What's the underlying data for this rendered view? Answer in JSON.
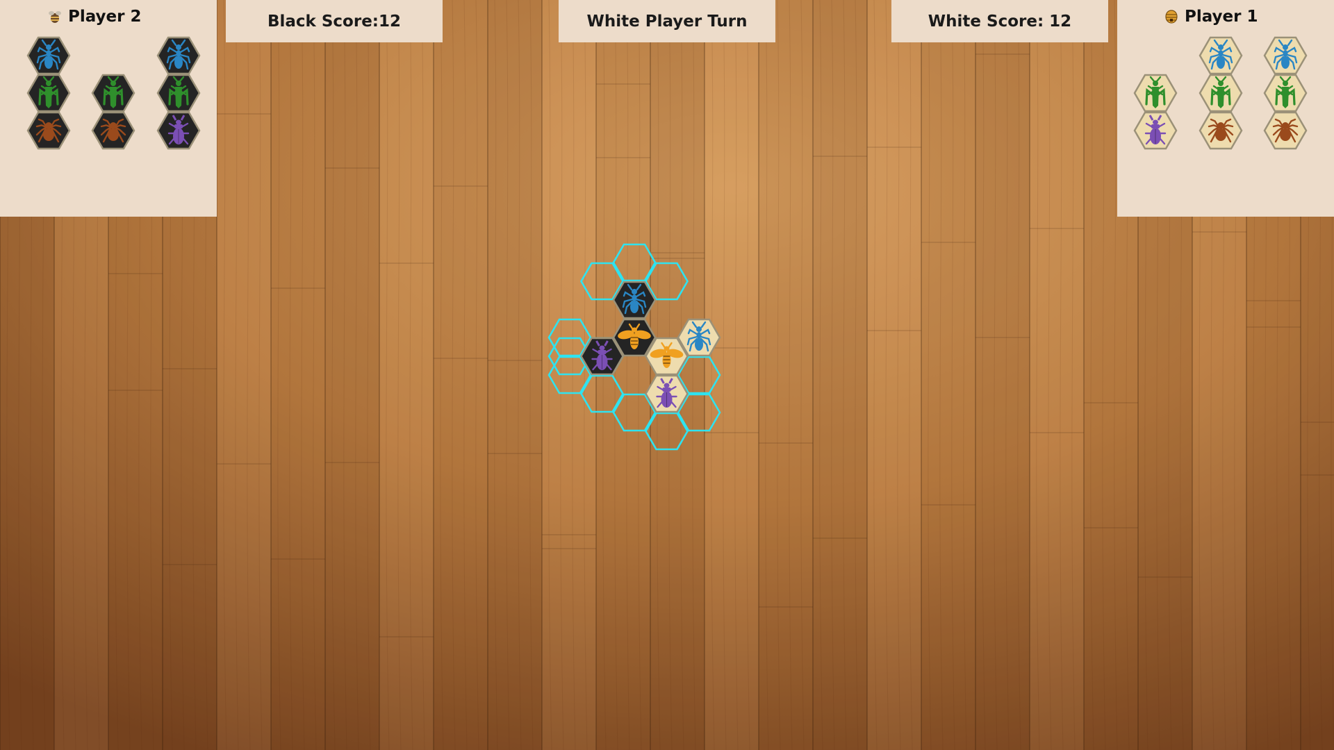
{
  "hud": {
    "black_score": "Black Score:12",
    "turn_status": "White Player Turn",
    "white_score": "White Score: 12"
  },
  "players": {
    "player2": {
      "name": "Player 2",
      "color": "black",
      "icon": "bee-icon",
      "hand": [
        {
          "bug": "ant",
          "icon": "ant-icon"
        },
        {
          "bug": "grasshopper",
          "icon": "grasshopper-icon"
        },
        {
          "bug": "spider",
          "icon": "spider-icon"
        },
        {
          "bug": "grasshopper",
          "icon": "grasshopper-icon"
        },
        {
          "bug": "spider",
          "icon": "spider-icon"
        },
        {
          "bug": "ant",
          "icon": "ant-icon"
        },
        {
          "bug": "grasshopper",
          "icon": "grasshopper-icon"
        },
        {
          "bug": "beetle",
          "icon": "beetle-icon"
        }
      ]
    },
    "player1": {
      "name": "Player 1",
      "color": "white",
      "icon": "beehive-icon",
      "hand": [
        {
          "bug": "grasshopper",
          "icon": "grasshopper-icon"
        },
        {
          "bug": "beetle",
          "icon": "beetle-icon"
        },
        {
          "bug": "ant",
          "icon": "ant-icon"
        },
        {
          "bug": "grasshopper",
          "icon": "grasshopper-icon"
        },
        {
          "bug": "spider",
          "icon": "spider-icon"
        },
        {
          "bug": "ant",
          "icon": "ant-icon"
        },
        {
          "bug": "grasshopper",
          "icon": "grasshopper-icon"
        },
        {
          "bug": "spider",
          "icon": "spider-icon"
        }
      ]
    }
  },
  "board": {
    "pieces": [
      {
        "owner": "black",
        "bug": "ant",
        "icon": "ant-icon"
      },
      {
        "owner": "black",
        "bug": "queen-bee",
        "icon": "bee-icon"
      },
      {
        "owner": "black",
        "bug": "beetle",
        "icon": "beetle-icon"
      },
      {
        "owner": "white",
        "bug": "ant",
        "icon": "ant-icon"
      },
      {
        "owner": "white",
        "bug": "queen-bee",
        "icon": "bee-icon"
      },
      {
        "owner": "white",
        "bug": "beetle",
        "icon": "beetle-icon"
      }
    ],
    "valid_move_count": 12
  },
  "colors": {
    "panel": "#eddcca",
    "black_tile": "#242424",
    "white_tile": "#eedcae",
    "tile_border": "#9b9178",
    "highlight": "#2ee3f0",
    "ant": "#2a86c4",
    "grasshopper": "#2f8f2c",
    "spider": "#9a4a1c",
    "beetle": "#7b4fb4",
    "bee": "#f0a020",
    "wood": "#b87a3f"
  }
}
